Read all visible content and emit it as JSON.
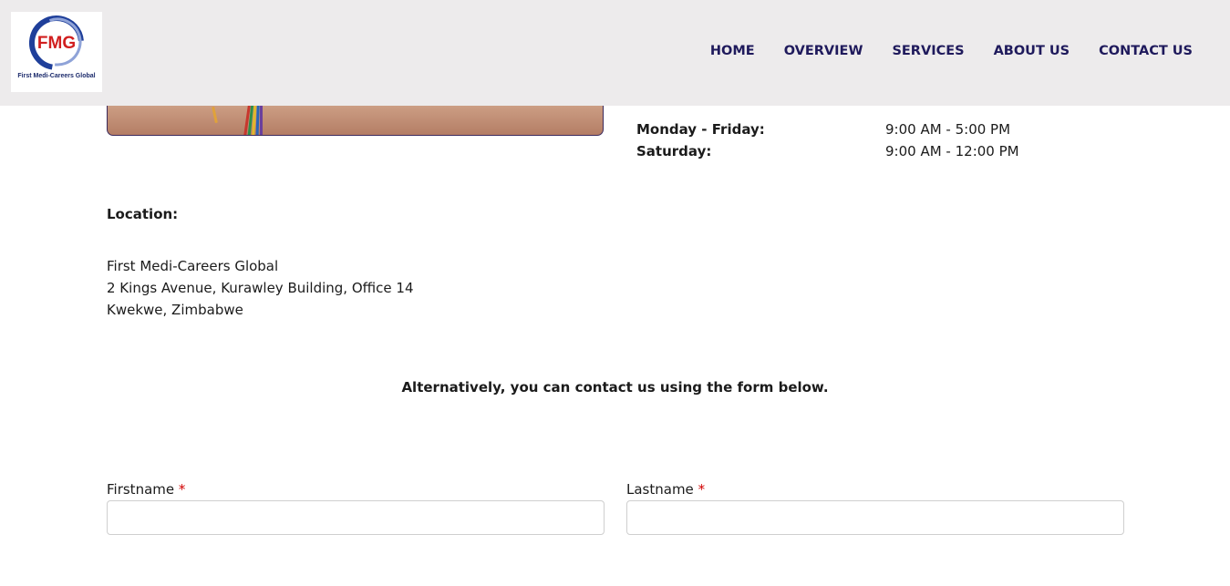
{
  "header": {
    "logo": {
      "initials": "FMG",
      "name": "First Medi-Careers Global"
    },
    "nav": [
      "HOME",
      "OVERVIEW",
      "SERVICES",
      "ABOUT US",
      "CONTACT US"
    ]
  },
  "hours": [
    {
      "day": "Monday - Friday:",
      "time": "9:00 AM - 5:00 PM"
    },
    {
      "day": "Saturday:",
      "time": "9:00 AM - 12:00 PM"
    }
  ],
  "location": {
    "heading": "Location:",
    "lines": [
      "First Medi-Careers Global",
      "2 Kings Avenue, Kurawley Building, Office 14",
      "Kwekwe, Zimbabwe"
    ]
  },
  "contact_note": "Alternatively, you can contact us using the form below.",
  "form": {
    "firstname": {
      "label": "Firstname",
      "required_mark": "*",
      "value": ""
    },
    "lastname": {
      "label": "Lastname",
      "required_mark": "*",
      "value": ""
    }
  },
  "colors": {
    "header_bg": "#edebec",
    "nav_text": "#1f1a5c",
    "logo_red": "#d11f1f",
    "logo_blue": "#1f3f9a",
    "required": "#d10000"
  }
}
